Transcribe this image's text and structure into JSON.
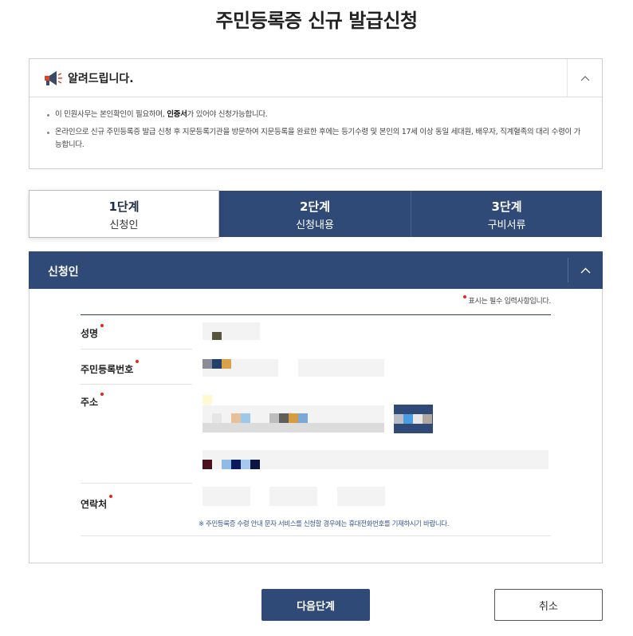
{
  "page": {
    "title": "주민등록증 신규 발급신청"
  },
  "notice": {
    "title": "알려드립니다.",
    "icon": "megaphone-icon",
    "item1_before": "이 민원사무는 본인확인이 필요하며, ",
    "item1_bold": "인증서",
    "item1_after": "가 있어야 신청가능합니다.",
    "item2": "온라인으로 신규 주민등록증 발급 신청 후 지문등록기관을 방문하여 지문등록을 완료한 후에는 등기수령 및 본인의 17세 이상 동일 세대원, 배우자, 직계혈족의 대리 수령이 가능합니다."
  },
  "steps": [
    {
      "num": "1단계",
      "name": "신청인",
      "active": true
    },
    {
      "num": "2단계",
      "name": "신청내용",
      "active": false
    },
    {
      "num": "3단계",
      "name": "구비서류",
      "active": false
    }
  ],
  "panel": {
    "title": "신청인",
    "required_note": "표시는 필수 입력사항입니다.",
    "labels": {
      "name": "성명",
      "rrn": "주민등록번호",
      "address": "주소",
      "contact": "연락처"
    },
    "hint": "※ 주민등록증 수령 안내 문자 서비스를 신청할 경우에는 휴대전화번호를 기재하시기 바랍니다."
  },
  "buttons": {
    "next": "다음단계",
    "cancel": "취소"
  },
  "colors": {
    "primary": "#304a77",
    "required": "#e0281b",
    "hint": "#3a5a8c"
  }
}
